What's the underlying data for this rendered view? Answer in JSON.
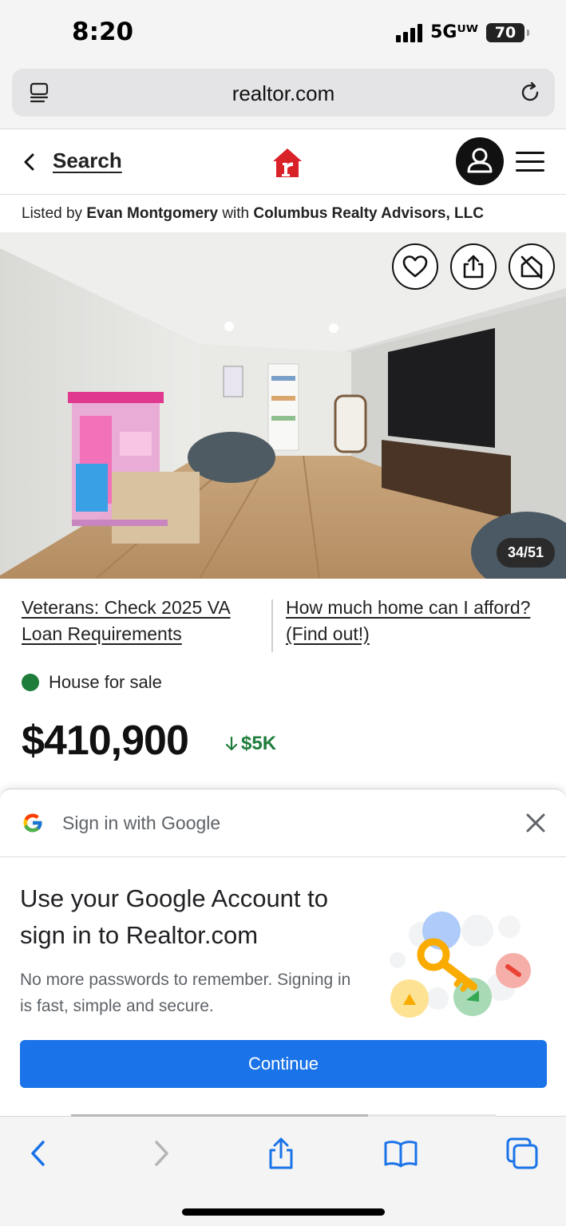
{
  "status_bar": {
    "time": "8:20",
    "network": "5Gᵁᵂ",
    "battery": "70"
  },
  "browser": {
    "url": "realtor.com",
    "page_load_progress_percent": 70
  },
  "site_header": {
    "back_label": "Search"
  },
  "listing": {
    "listed_by_prefix": "Listed by",
    "agent_name": "Evan Montgomery",
    "with_word": "with",
    "brokerage": "Columbus Realty Advisors, LLC",
    "photo_counter": "34/51",
    "link_left": "Veterans: Check 2025 VA Loan Requirements",
    "link_right": "How much home can I afford? (Find out!)",
    "status": "House for sale",
    "status_color": "#1e7d3a",
    "price": "$410,900",
    "price_drop": "$5K"
  },
  "google_signin": {
    "header_title": "Sign in with Google",
    "title": "Use your Google Account to sign in to Realtor.com",
    "body": "No more passwords to remember. Signing in is fast, simple and secure.",
    "continue_label": "Continue",
    "button_color": "#1a73e8"
  },
  "icons": {
    "tabs": "tab-overview-icon",
    "reload": "reload-icon",
    "avatar": "user-icon",
    "menu": "hamburger-menu-icon",
    "favorite": "heart-icon",
    "share": "share-icon",
    "hide": "hide-listing-icon"
  }
}
